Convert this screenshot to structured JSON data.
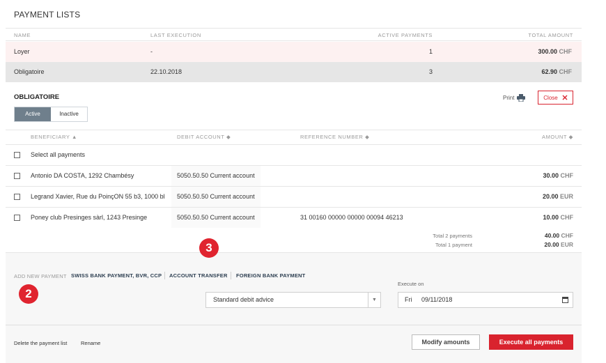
{
  "page": {
    "title": "PAYMENT LISTS"
  },
  "payment_lists": {
    "headers": {
      "name": "NAME",
      "last_execution": "LAST EXECUTION",
      "active_payments": "ACTIVE PAYMENTS",
      "total_amount": "TOTAL AMOUNT"
    },
    "rows": [
      {
        "name": "Loyer",
        "last_execution": "-",
        "active_payments": "1",
        "amount": "300.00",
        "currency": "CHF"
      },
      {
        "name": "Obligatoire",
        "last_execution": "22.10.2018",
        "active_payments": "3",
        "amount": "62.90",
        "currency": "CHF"
      }
    ]
  },
  "detail": {
    "title": "OBLIGATOIRE",
    "toggle": {
      "active": "Active",
      "inactive": "Inactive"
    },
    "print_label": "Print",
    "close_label": "Close",
    "headers": {
      "beneficiary": "BENEFICIARY ▲",
      "debit_account": "DEBIT ACCOUNT ◆",
      "reference": "REFERENCE NUMBER ◆",
      "amount": "AMOUNT ◆"
    },
    "select_all": "Select all payments",
    "payments": [
      {
        "beneficiary": "Antonio DA COSTA, 1292 Chambésy",
        "debit_account": "5050.50.50 Current account",
        "reference": "",
        "amount": "30.00",
        "currency": "CHF"
      },
      {
        "beneficiary": "Legrand Xavier, Rue du PoinçON 55 b3, 1000 bl",
        "debit_account": "5050.50.50 Current account",
        "reference": "",
        "amount": "20.00",
        "currency": "EUR"
      },
      {
        "beneficiary": "Poney club Presinges sàrl, 1243 Presinge",
        "debit_account": "5050.50.50 Current account",
        "reference": "31 00160 00000 00000 00094 46213",
        "amount": "10.00",
        "currency": "CHF"
      }
    ],
    "totals": [
      {
        "label": "Total 2 payments",
        "amount": "40.00",
        "currency": "CHF"
      },
      {
        "label": "Total 1 payment",
        "amount": "20.00",
        "currency": "EUR"
      }
    ]
  },
  "add_payment": {
    "label": "ADD NEW PAYMENT",
    "links": [
      "SWISS BANK PAYMENT, BVR, CCP",
      "ACCOUNT TRANSFER",
      "FOREIGN BANK PAYMENT"
    ]
  },
  "debit_advice": {
    "value": "Standard debit advice"
  },
  "execute_on": {
    "label": "Execute on",
    "day": "Fri",
    "date": "09/11/2018"
  },
  "footer": {
    "delete_label": "Delete the payment list",
    "rename_label": "Rename",
    "modify_label": "Modify amounts",
    "execute_label": "Execute all payments"
  },
  "annotations": {
    "badge_2": "2",
    "badge_3": "3"
  },
  "colors": {
    "accent_red": "#d9232e",
    "selected_row": "#e6e6e6",
    "highlight_row": "#fdf1f1",
    "toggle_active": "#6f7f8c"
  },
  "icons": {
    "print": "printer-icon",
    "close": "close-x-icon",
    "calendar": "calendar-icon",
    "dropdown": "chevron-down-icon"
  }
}
